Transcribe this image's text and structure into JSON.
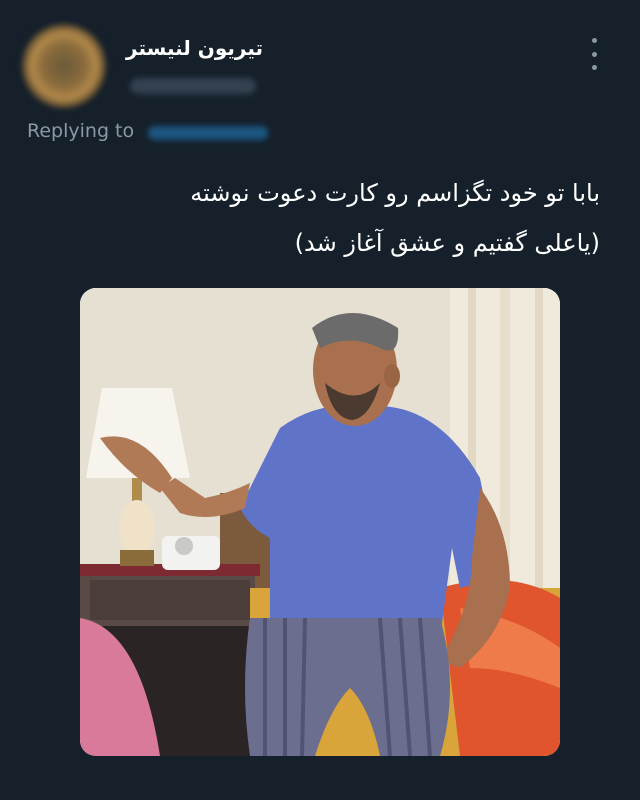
{
  "author": {
    "display_name": "تیریون لنیستر"
  },
  "reply": {
    "label": "Replying to"
  },
  "tweet": {
    "line1": "بابا تو خود تگزاسم رو کارت دعوت نوشته",
    "line2": "(یاعلی گفتیم و عشق آغاز شد)"
  },
  "icons": {
    "more": "more-vertical-icon"
  },
  "colors": {
    "background": "#15202b",
    "secondary_text": "#8b98a5",
    "primary_text": "#ffffff"
  }
}
